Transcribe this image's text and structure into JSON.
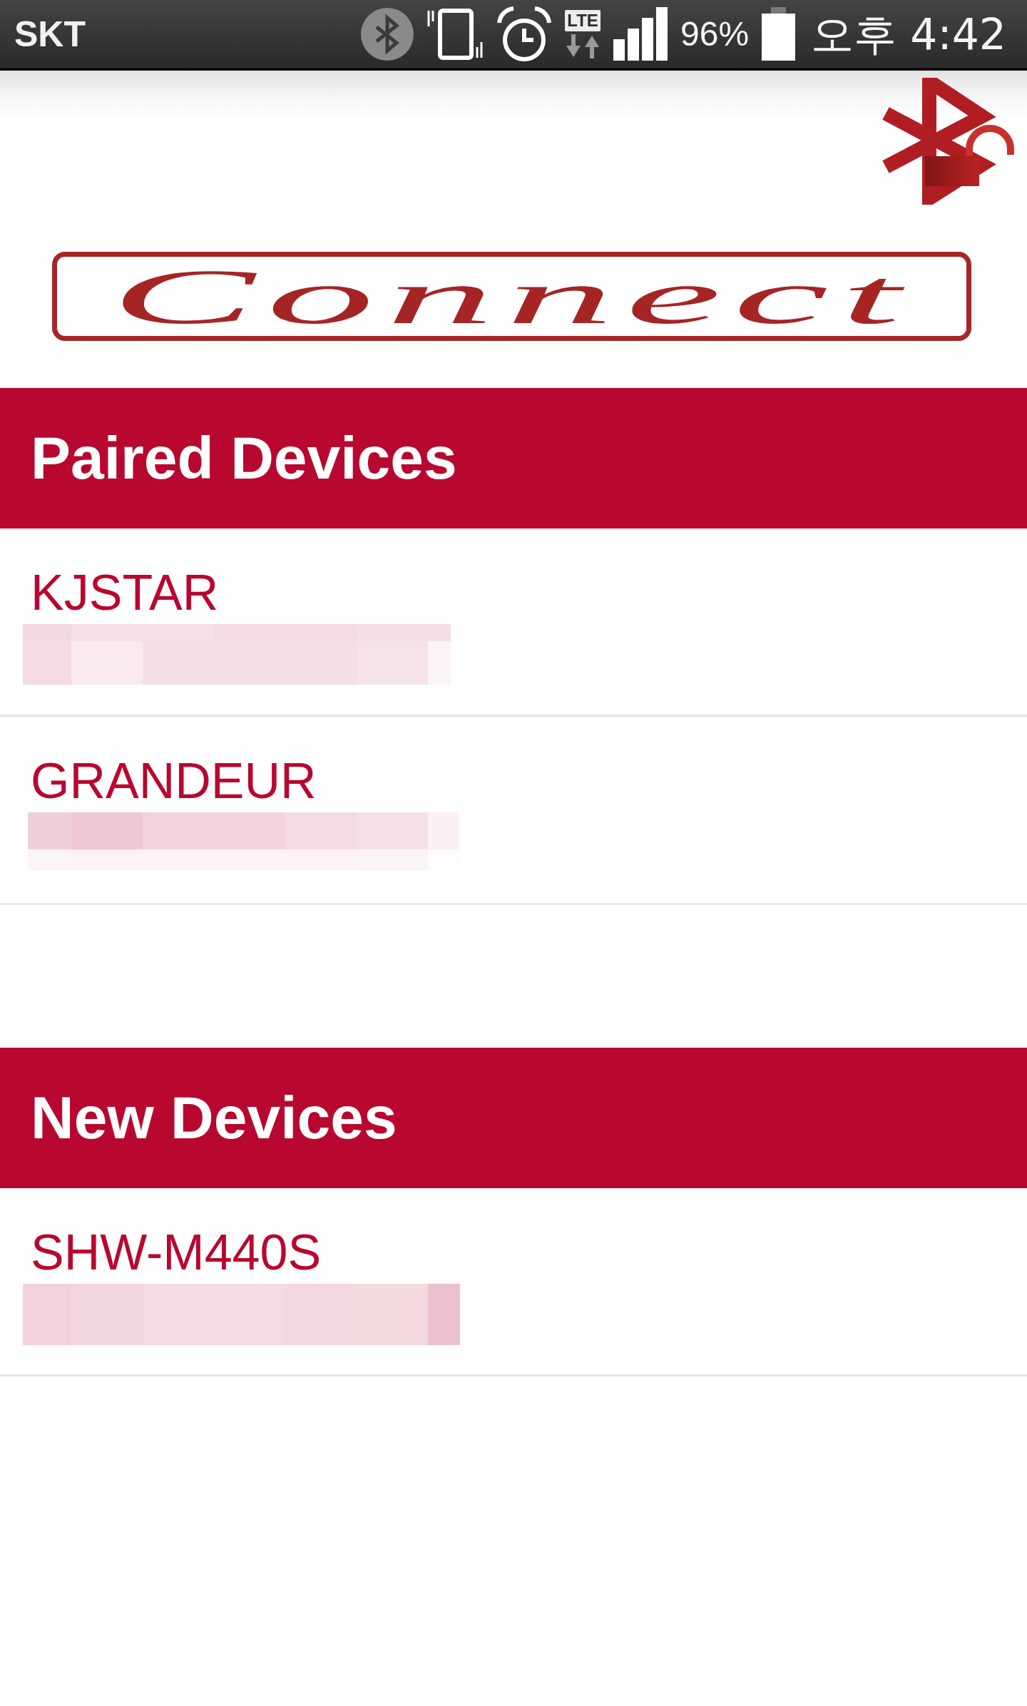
{
  "status_bar": {
    "carrier": "SKT",
    "network": "LTE",
    "battery": "96%",
    "time": "오후 4:42"
  },
  "header": {
    "logo": {
      "text": "Connect"
    }
  },
  "sections": [
    {
      "title": "Paired Devices",
      "devices": [
        {
          "name": "KJSTAR"
        },
        {
          "name": "GRANDEUR"
        }
      ]
    },
    {
      "title": "New Devices",
      "devices": [
        {
          "name": "SHW-M440S"
        }
      ]
    }
  ]
}
